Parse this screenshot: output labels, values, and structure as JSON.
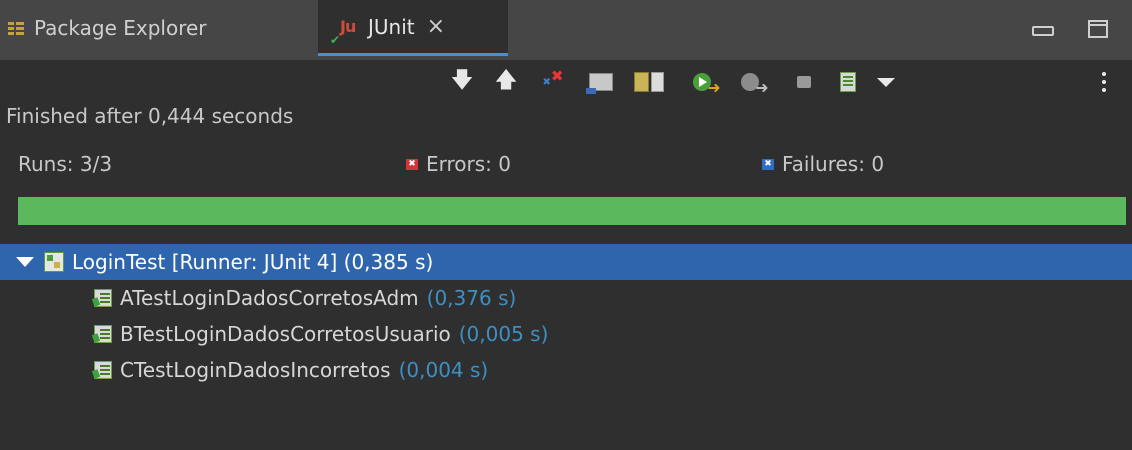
{
  "tabs": {
    "package_explorer": "Package Explorer",
    "junit": "JUnit"
  },
  "status": {
    "finished": "Finished after 0,444 seconds",
    "runs_label": "Runs:",
    "runs_value": "3/3",
    "errors_label": "Errors:",
    "errors_value": "0",
    "failures_label": "Failures:",
    "failures_value": "0",
    "progress_fraction": 1.0,
    "progress_color": "#5cb85c"
  },
  "tree": {
    "root": {
      "label": "LoginTest [Runner: JUnit 4]",
      "time": "(0,385 s)"
    },
    "tests": [
      {
        "name": "ATestLoginDadosCorretosAdm",
        "time": "(0,376 s)"
      },
      {
        "name": "BTestLoginDadosCorretosUsuario",
        "time": "(0,005 s)"
      },
      {
        "name": "CTestLoginDadosIncorretos",
        "time": "(0,004 s)"
      }
    ]
  },
  "colors": {
    "selection": "#2f65ad",
    "time_text": "#3d8fc4",
    "background": "#2f2f2f",
    "tabbar": "#464646"
  },
  "icons": {
    "toolbar": [
      "next-failure-icon",
      "previous-failure-icon",
      "show-failures-only-icon",
      "scroll-lock-icon",
      "test-run-history-icon",
      "rerun-test-icon",
      "rerun-failed-first-icon",
      "stop-icon",
      "layout-icon",
      "view-menu-icon",
      "more-options-icon"
    ]
  }
}
